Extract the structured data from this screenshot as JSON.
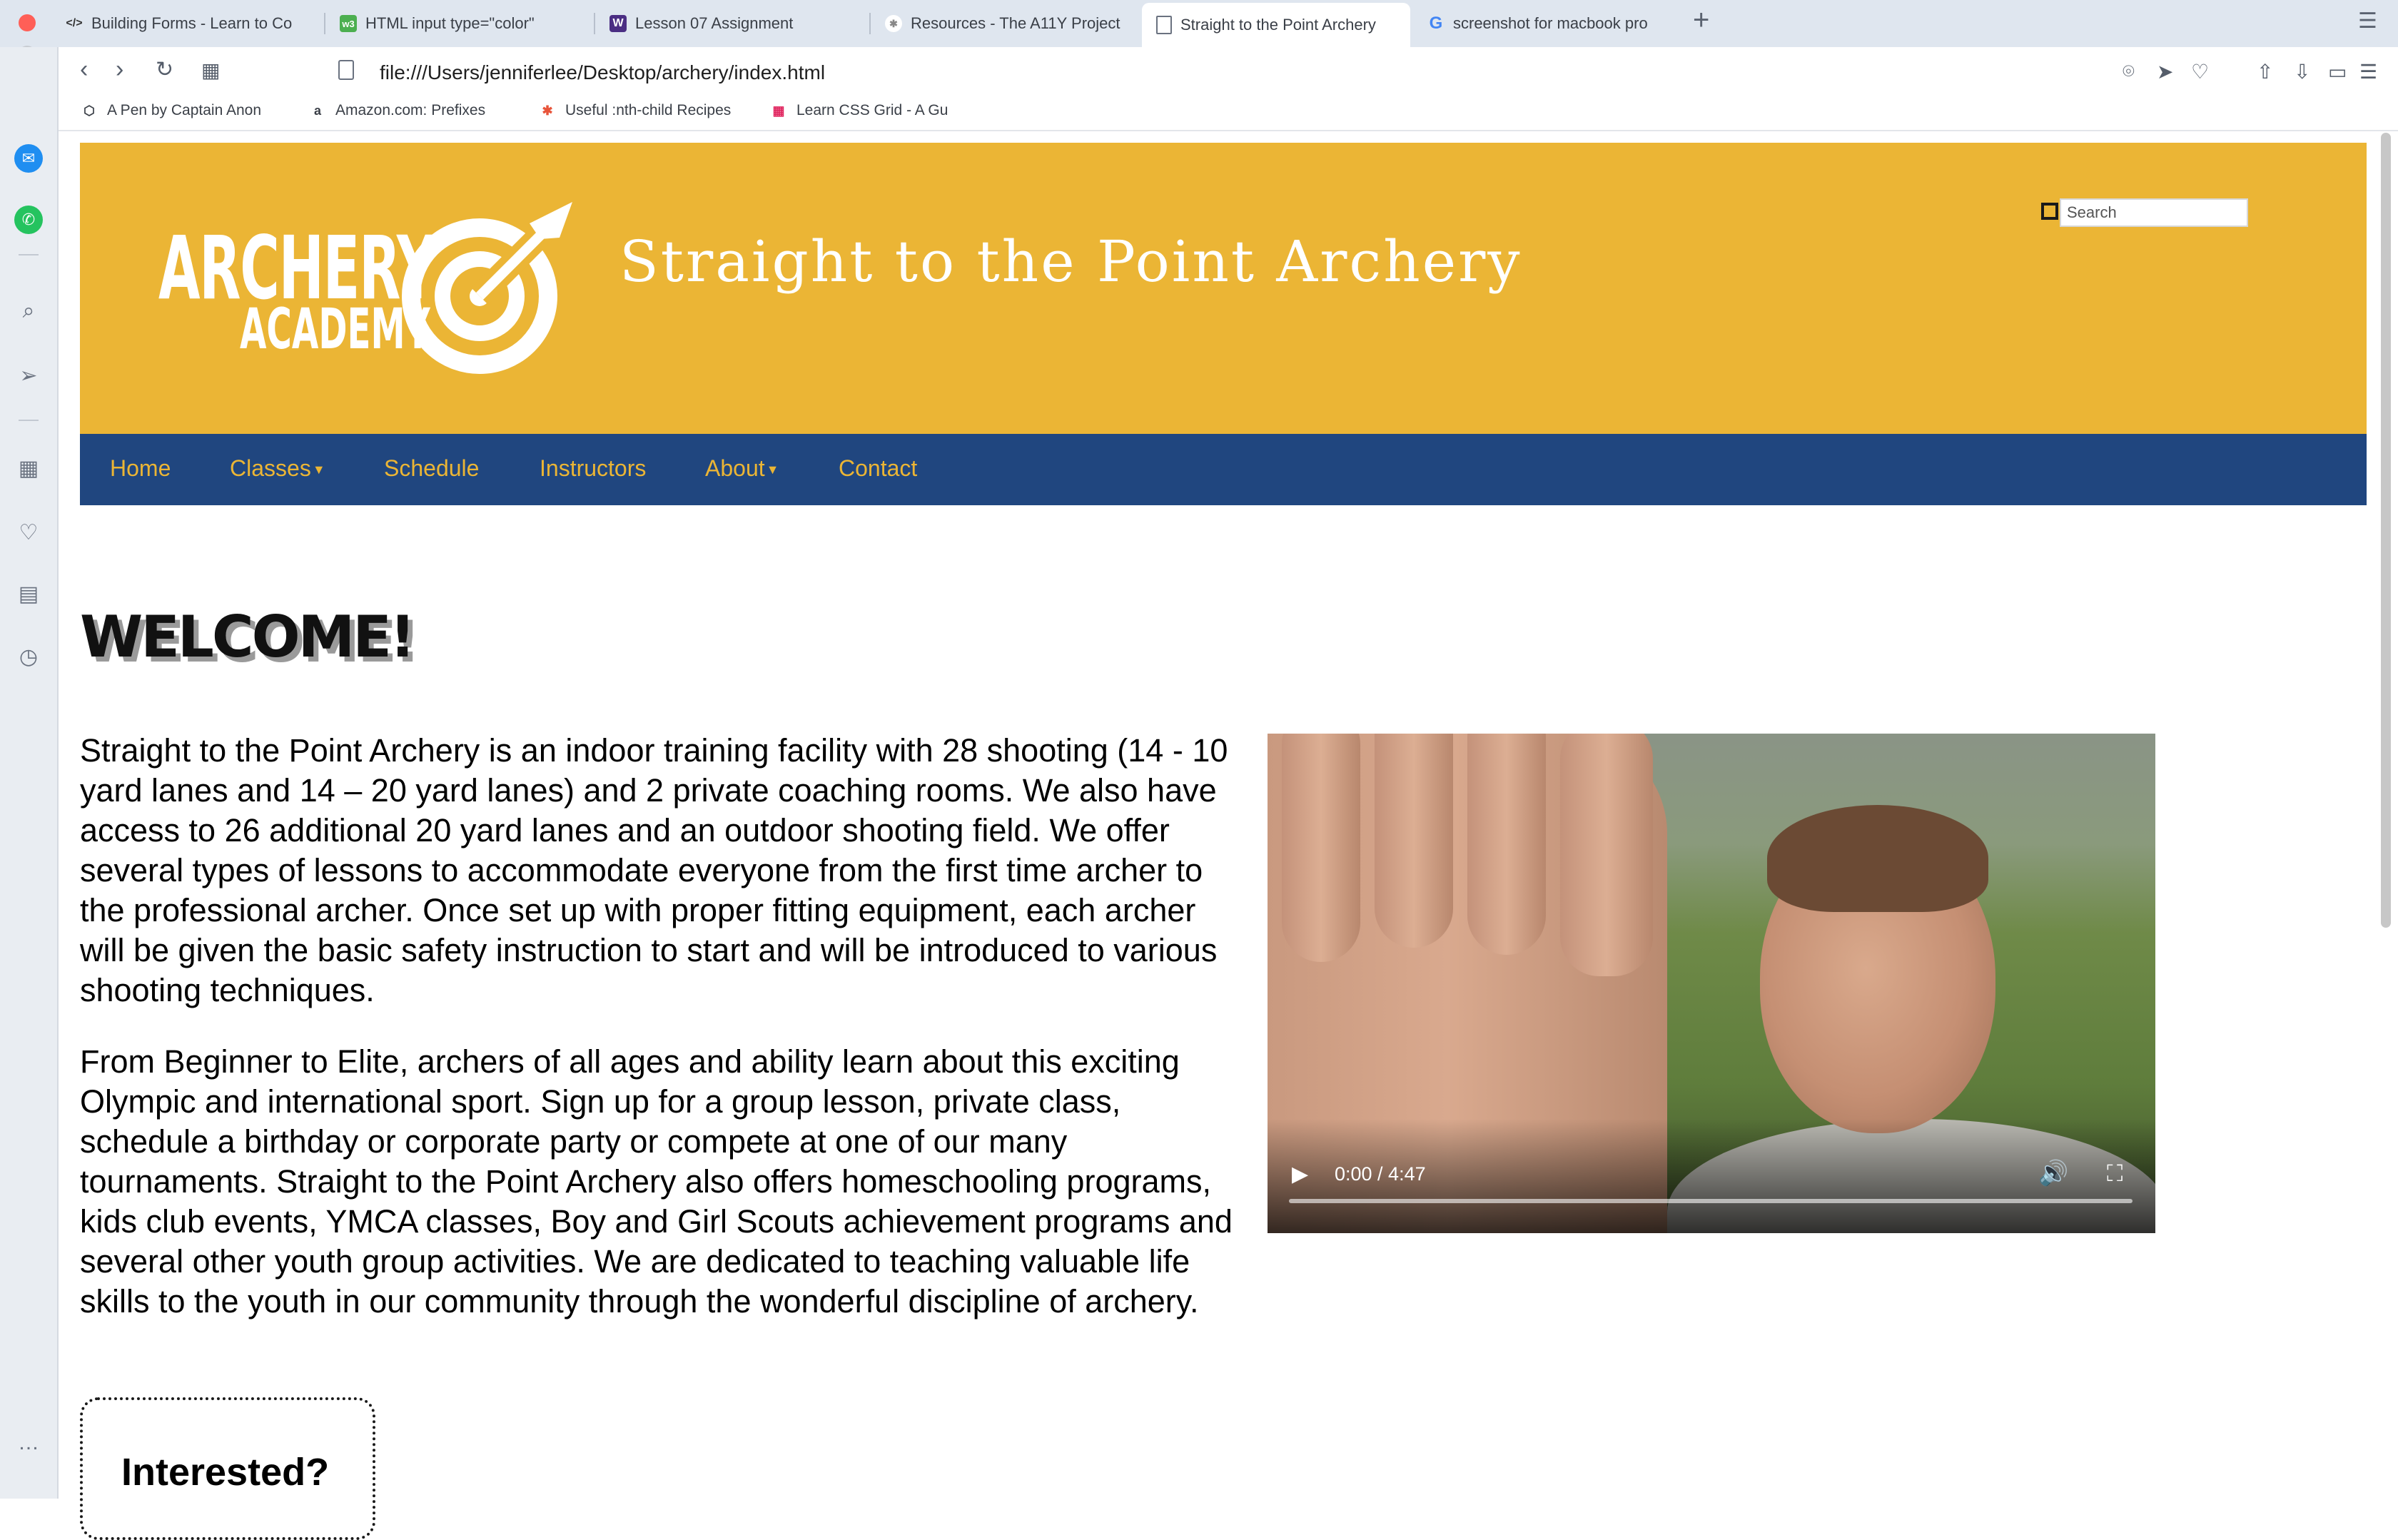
{
  "browser": {
    "tabs": [
      {
        "label": "Building Forms - Learn to Co",
        "icon": "code-icon"
      },
      {
        "label": "HTML input type=\"color\"",
        "icon": "w3-icon"
      },
      {
        "label": "Lesson 07 Assignment",
        "icon": "w-icon"
      },
      {
        "label": "Resources - The A11Y Project",
        "icon": "a11y-icon"
      },
      {
        "label": "Straight to the Point Archery",
        "icon": "document-icon",
        "active": true
      },
      {
        "label": "screenshot for macbook pro",
        "icon": "google-icon"
      }
    ],
    "url": "file:///Users/jenniferlee/Desktop/archery/index.html",
    "bookmarks": [
      {
        "label": "A Pen by Captain Anon",
        "icon": "codepen-icon"
      },
      {
        "label": "Amazon.com: Prefixes",
        "icon": "amazon-icon"
      },
      {
        "label": "Useful :nth-child Recipes",
        "icon": "css-tricks-icon"
      },
      {
        "label": "Learn CSS Grid - A Gu",
        "icon": "grid-icon"
      }
    ]
  },
  "site": {
    "logo": {
      "line1": "ARCHERY",
      "line2": "ACADEMY"
    },
    "title": "Straight to the Point Archery",
    "search": {
      "placeholder": "Search"
    },
    "nav": [
      {
        "label": "Home",
        "dropdown": false
      },
      {
        "label": "Classes",
        "dropdown": true
      },
      {
        "label": "Schedule",
        "dropdown": false
      },
      {
        "label": "Instructors",
        "dropdown": false
      },
      {
        "label": "About",
        "dropdown": true
      },
      {
        "label": "Contact",
        "dropdown": false
      }
    ],
    "heading": "WELCOME!",
    "paragraphs": [
      "Straight to the Point Archery is an indoor training facility with 28 shooting (14 - 10 yard lanes and 14 – 20 yard lanes) and 2 private coaching rooms. We also have access to 26 additional 20 yard lanes and an outdoor shooting field. We offer several types of lessons to accommodate everyone from the first time archer to the professional archer. Once set up with proper fitting equipment, each archer will be given the basic safety instruction to start and will be introduced to various shooting techniques.",
      "From Beginner to Elite, archers of all ages and ability learn about this exciting Olympic and international sport. Sign up for a group lesson, private class, schedule a birthday or corporate party or compete at one of our many tournaments. Straight to the Point Archery also offers homeschooling programs, kids club events, YMCA classes, Boy and Girl Scouts achievement programs and several other youth group activities. We are dedicated to teaching valuable life skills to the youth in our community through the wonderful discipline of archery."
    ],
    "video": {
      "time": "0:00 / 4:47",
      "progress": 0
    },
    "cta": {
      "title": "Interested?"
    }
  },
  "colors": {
    "header_bg": "#ebb535",
    "nav_bg": "#20467f",
    "nav_text": "#ebb535"
  }
}
